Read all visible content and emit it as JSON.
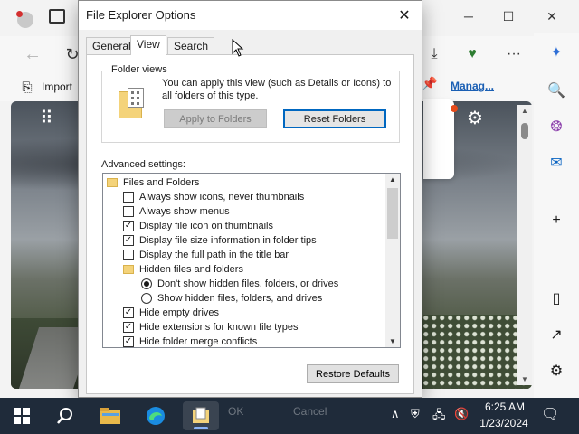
{
  "dialog": {
    "title": "File Explorer Options",
    "tabs": [
      "General",
      "View",
      "Search"
    ],
    "active_tab": "View",
    "folder_views": {
      "legend": "Folder views",
      "description": "You can apply this view (such as Details or Icons) to all folders of this type.",
      "apply_button": "Apply to Folders",
      "reset_button": "Reset Folders"
    },
    "advanced_label": "Advanced settings:",
    "advanced_items": [
      {
        "type": "folder",
        "label": "Files and Folders",
        "indent": 0
      },
      {
        "type": "checkbox",
        "label": "Always show icons, never thumbnails",
        "checked": false,
        "indent": 1
      },
      {
        "type": "checkbox",
        "label": "Always show menus",
        "checked": false,
        "indent": 1
      },
      {
        "type": "checkbox",
        "label": "Display file icon on thumbnails",
        "checked": true,
        "indent": 1
      },
      {
        "type": "checkbox",
        "label": "Display file size information in folder tips",
        "checked": true,
        "indent": 1
      },
      {
        "type": "checkbox",
        "label": "Display the full path in the title bar",
        "checked": false,
        "indent": 1
      },
      {
        "type": "folder",
        "label": "Hidden files and folders",
        "indent": 1
      },
      {
        "type": "radio",
        "label": "Don't show hidden files, folders, or drives",
        "checked": true,
        "indent": 2
      },
      {
        "type": "radio",
        "label": "Show hidden files, folders, and drives",
        "checked": false,
        "indent": 2
      },
      {
        "type": "checkbox",
        "label": "Hide empty drives",
        "checked": true,
        "indent": 1
      },
      {
        "type": "checkbox",
        "label": "Hide extensions for known file types",
        "checked": true,
        "indent": 1
      },
      {
        "type": "checkbox",
        "label": "Hide folder merge conflicts",
        "checked": true,
        "indent": 1
      }
    ],
    "restore_button": "Restore Defaults",
    "ok_button": "OK",
    "cancel_button": "Cancel"
  },
  "browser": {
    "import_label": "Import",
    "manage_link": "Manag..."
  },
  "taskbar": {
    "time": "6:25 AM",
    "date": "1/23/2024"
  },
  "colors": {
    "accent": "#0067c0",
    "taskbar": "#1f2b3a",
    "folder": "#f4d37a"
  }
}
